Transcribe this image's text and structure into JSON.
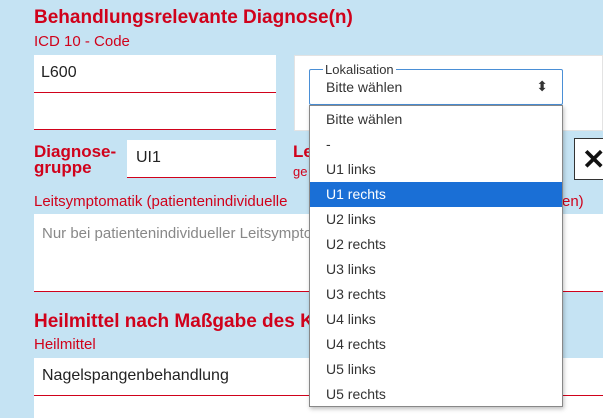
{
  "diagnose": {
    "title": "Behandlungsrelevante Diagnose(n)",
    "icd_label": "ICD 10 - Code",
    "icd_value": "L600",
    "icd_value2": "",
    "group_label_line1": "Diagnose-",
    "group_label_line2": "gruppe",
    "group_value": "UI1",
    "right_label_1": "Le",
    "right_label_2": "ge",
    "close_glyph": "✕",
    "leitsymptomatik_label": "Leitsymptomatik (patientenindividuelle",
    "leitsymptomatik_label_end": "en)",
    "leitsymptomatik_placeholder": "Nur bei patientenindividueller Leitsymptomatik"
  },
  "lokalisation": {
    "legend": "Lokalisation",
    "selected": "Bitte wählen",
    "arrow_glyph": "⬍",
    "options": [
      "Bitte wählen",
      "-",
      "U1 links",
      "U1 rechts",
      "U2 links",
      "U2 rechts",
      "U3 links",
      "U3 rechts",
      "U4 links",
      "U4 rechts",
      "U5 links",
      "U5 rechts"
    ],
    "highlighted": "U1 rechts"
  },
  "heilmittel": {
    "title": "Heilmittel nach Maßgabe des K",
    "label": "Heilmittel",
    "value": "Nagelspangenbehandlung"
  },
  "colors": {
    "background": "#c5e3f3",
    "accent_red": "#d0021b",
    "selected_blue": "#1a6fd6"
  }
}
